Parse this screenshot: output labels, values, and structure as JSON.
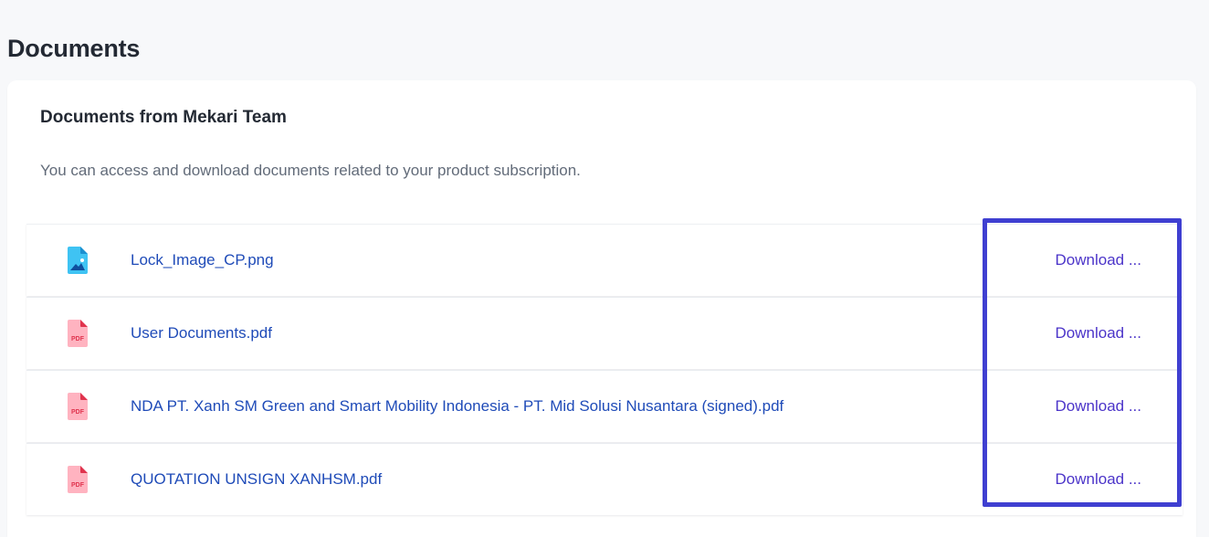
{
  "page": {
    "title": "Documents"
  },
  "card": {
    "title": "Documents from Mekari Team",
    "description": "You can access and download documents related to your product subscription."
  },
  "documents": [
    {
      "name": "Lock_Image_CP.png",
      "icon": "image-file-icon",
      "action": "Download ..."
    },
    {
      "name": "User Documents.pdf",
      "icon": "pdf-file-icon",
      "action": "Download ..."
    },
    {
      "name": "NDA PT. Xanh SM Green and Smart Mobility Indonesia - PT. Mid Solusi Nusantara (signed).pdf",
      "icon": "pdf-file-icon",
      "action": "Download ..."
    },
    {
      "name": "QUOTATION UNSIGN XANHSM.pdf",
      "icon": "pdf-file-icon",
      "action": "Download ..."
    }
  ],
  "icons": {
    "pdf_label": "PDF"
  },
  "colors": {
    "link": "#1f4bb8",
    "download": "#4b34c9",
    "highlight": "#3f3fd1",
    "pdf_icon": "#f46a80",
    "image_icon": "#37b8f0"
  }
}
